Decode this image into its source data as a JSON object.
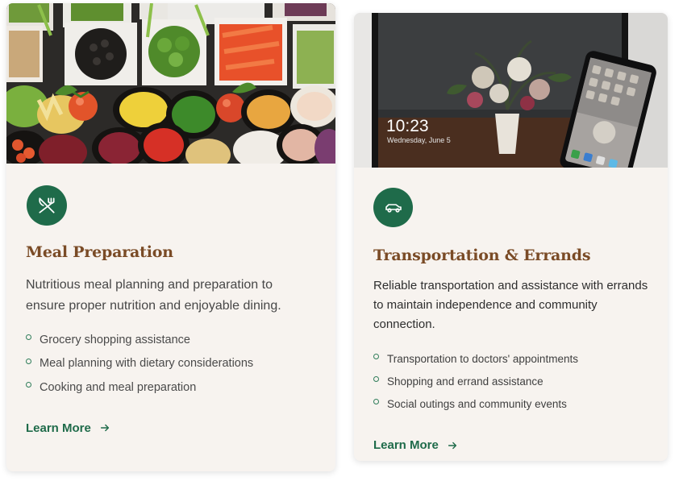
{
  "cards": [
    {
      "title": "Meal Preparation",
      "description": "Nutritious meal planning and preparation to ensure proper nutrition and enjoyable dining.",
      "features": [
        "Grocery shopping assistance",
        "Meal planning with dietary considerations",
        "Cooking and meal preparation"
      ],
      "link_label": "Learn More",
      "icon": "fork-knife-icon",
      "image": "salad-bar-photo"
    },
    {
      "title": "Transportation & Errands",
      "description": "Reliable transportation and assistance with errands to maintain independence and community connection.",
      "features": [
        "Transportation to doctors' appointments",
        "Shopping and errand assistance",
        "Social outings and community events"
      ],
      "link_label": "Learn More",
      "icon": "car-icon",
      "image": "tablet-phone-photo",
      "image_text": {
        "time": "10:23",
        "date": "Wednesday, June 5"
      }
    }
  ],
  "colors": {
    "accent": "#1f6b4a",
    "title": "#7a4b26",
    "card_bg": "#f7f3ef"
  }
}
